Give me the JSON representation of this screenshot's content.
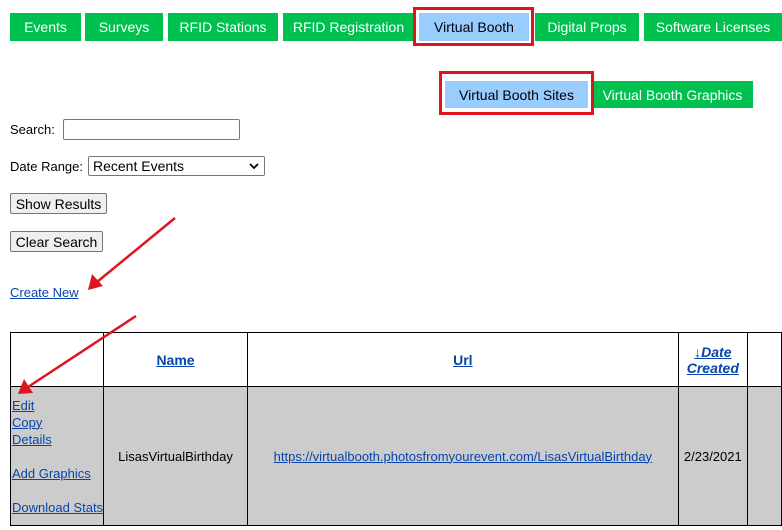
{
  "nav": {
    "tabs": [
      {
        "label": "Events"
      },
      {
        "label": "Surveys"
      },
      {
        "label": "RFID Stations"
      },
      {
        "label": "RFID Registration"
      },
      {
        "label": "Virtual Booth"
      },
      {
        "label": "Digital Props"
      },
      {
        "label": "Software Licenses"
      }
    ],
    "active": "Virtual Booth"
  },
  "subtabs": [
    {
      "label": "Virtual Booth Sites"
    },
    {
      "label": "Virtual Booth Graphics"
    }
  ],
  "filters": {
    "search_label": "Search:",
    "search_value": "",
    "date_range_label": "Date Range:",
    "date_range_value": "Recent Events",
    "show_results": "Show Results",
    "clear_search": "Clear Search"
  },
  "create_new": "Create New",
  "table": {
    "headers": {
      "name": "Name",
      "url": "Url",
      "date": "↓Date Created"
    },
    "rows": [
      {
        "actions": {
          "edit": "Edit",
          "copy": "Copy",
          "details": "Details",
          "add_graphics": "Add Graphics",
          "download_stats": "Download Stats"
        },
        "name": "LisasVirtualBirthday",
        "url": "https://virtualbooth.photosfromyourevent.com/LisasVirtualBirthday",
        "date": "2/23/2021"
      }
    ]
  },
  "colors": {
    "tab_bg": "#00c050",
    "tab_active_bg": "#99ccff",
    "highlight": "#e0141e",
    "row_bg": "#cccccc",
    "link": "#0645ad"
  }
}
